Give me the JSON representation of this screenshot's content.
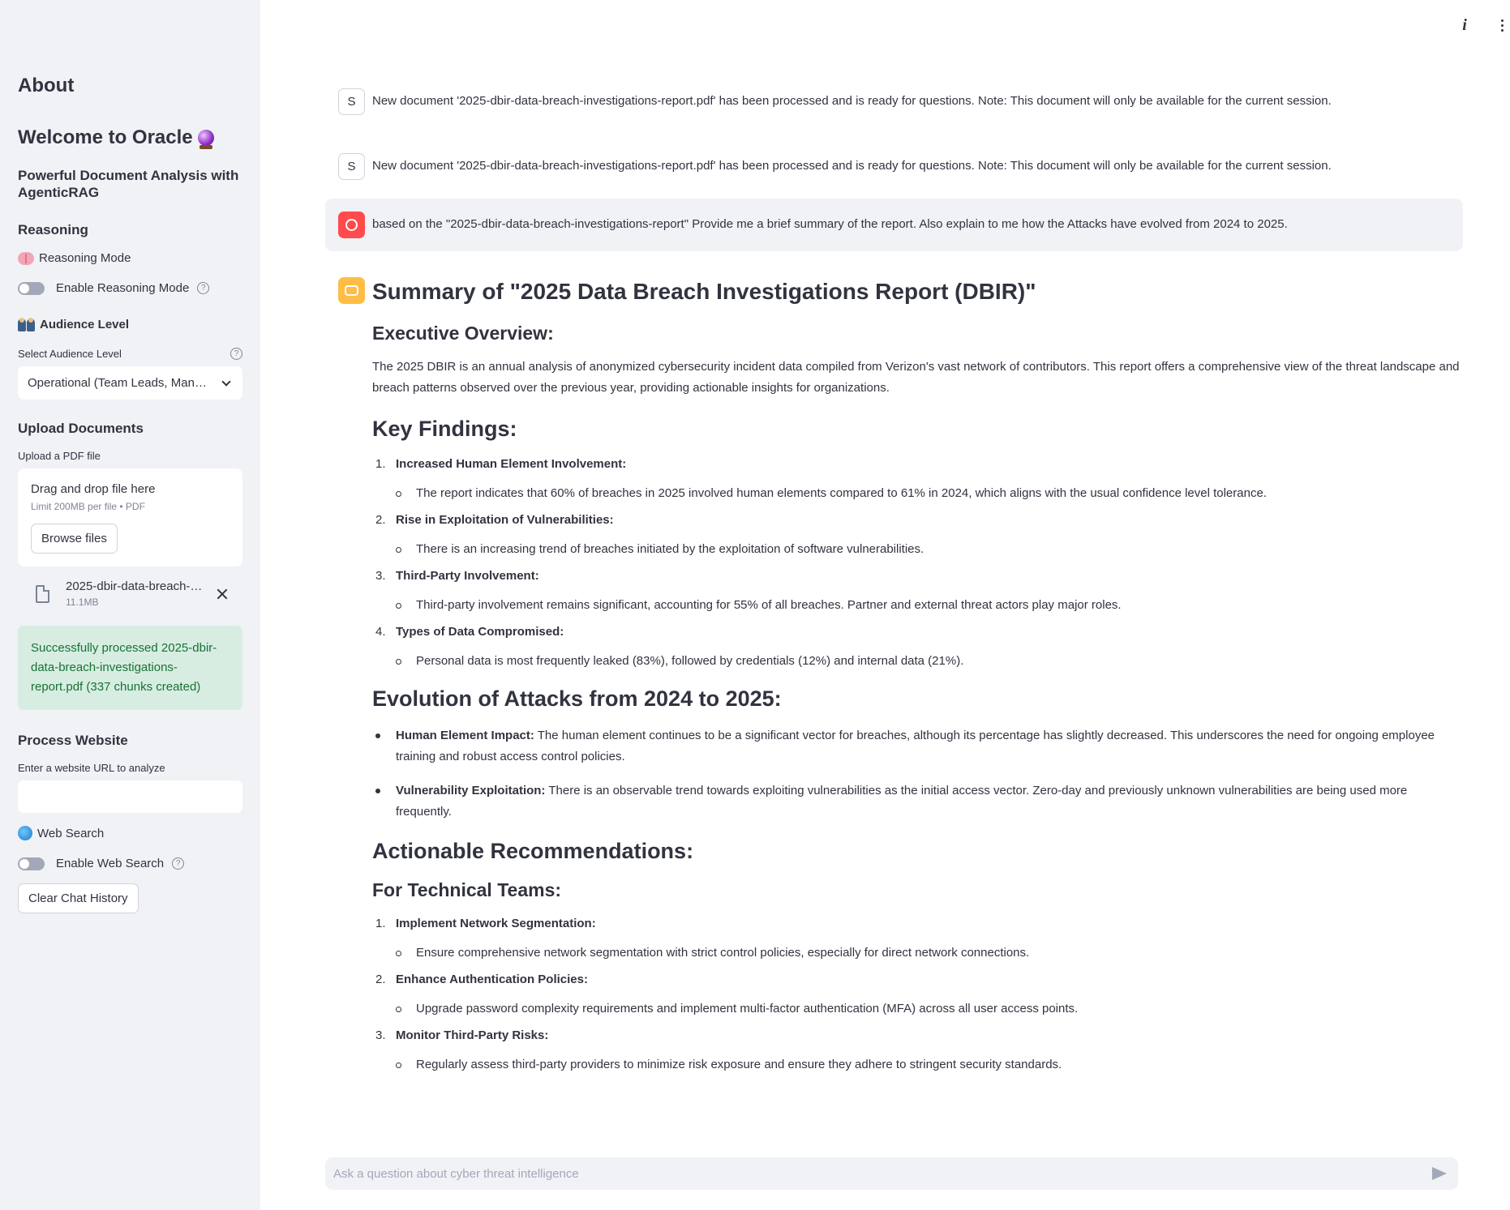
{
  "sidebar": {
    "about": "About",
    "welcome": "Welcome to Oracle",
    "subtitle": "Powerful Document Analysis with AgenticRAG",
    "reasoning": {
      "heading": "Reasoning",
      "mode_label": "Reasoning Mode",
      "toggle_label": "Enable Reasoning Mode"
    },
    "audience": {
      "heading": "Audience Level",
      "select_label": "Select Audience Level",
      "selected": "Operational (Team Leads, Man…"
    },
    "upload": {
      "heading": "Upload Documents",
      "label": "Upload a PDF file",
      "drop_text": "Drag and drop file here",
      "limit": "Limit 200MB per file • PDF",
      "browse": "Browse files",
      "file_name": "2025-dbir-data-breach-…",
      "file_size": "11.1MB",
      "success": "Successfully processed 2025-dbir-data-breach-investigations-report.pdf (337 chunks created)"
    },
    "website": {
      "heading": "Process Website",
      "label": "Enter a website URL to analyze",
      "value": ""
    },
    "web_search": {
      "label": "Web Search",
      "toggle_label": "Enable Web Search"
    },
    "clear_button": "Clear Chat History"
  },
  "chat": {
    "system_messages": [
      {
        "avatar": "S",
        "text": "New document '2025-dbir-data-breach-investigations-report.pdf' has been processed and is ready for questions. Note: This document will only be available for the current session."
      },
      {
        "avatar": "S",
        "text": "New document '2025-dbir-data-breach-investigations-report.pdf' has been processed and is ready for questions. Note: This document will only be available for the current session."
      }
    ],
    "user_message": "based on the \"2025-dbir-data-breach-investigations-report\" Provide me a brief summary of the report. Also explain to me how the Attacks have evolved from 2024 to 2025.",
    "response": {
      "title": "Summary of \"2025 Data Breach Investigations Report (DBIR)\"",
      "exec_heading": "Executive Overview:",
      "exec_text": "The 2025 DBIR is an annual analysis of anonymized cybersecurity incident data compiled from Verizon's vast network of contributors. This report offers a comprehensive view of the threat landscape and breach patterns observed over the previous year, providing actionable insights for organizations.",
      "key_heading": "Key Findings:",
      "key_findings": [
        {
          "num": "1.",
          "title": "Increased Human Element Involvement:",
          "detail": "The report indicates that 60% of breaches in 2025 involved human elements compared to 61% in 2024, which aligns with the usual confidence level tolerance."
        },
        {
          "num": "2.",
          "title": "Rise in Exploitation of Vulnerabilities:",
          "detail": "There is an increasing trend of breaches initiated by the exploitation of software vulnerabilities."
        },
        {
          "num": "3.",
          "title": "Third-Party Involvement:",
          "detail": "Third-party involvement remains significant, accounting for 55% of all breaches. Partner and external threat actors play major roles."
        },
        {
          "num": "4.",
          "title": "Types of Data Compromised:",
          "detail": "Personal data is most frequently leaked (83%), followed by credentials (12%) and internal data (21%)."
        }
      ],
      "evolution_heading": "Evolution of Attacks from 2024 to 2025:",
      "evolution": [
        {
          "title": "Human Element Impact:",
          "text": " The human element continues to be a significant vector for breaches, although its percentage has slightly decreased. This underscores the need for ongoing employee training and robust access control policies."
        },
        {
          "title": "Vulnerability Exploitation:",
          "text": " There is an observable trend towards exploiting vulnerabilities as the initial access vector. Zero-day and previously unknown vulnerabilities are being used more frequently."
        }
      ],
      "recs_heading": "Actionable Recommendations:",
      "tech_heading": "For Technical Teams:",
      "tech_recs": [
        {
          "num": "1.",
          "title": "Implement Network Segmentation:",
          "detail": "Ensure comprehensive network segmentation with strict control policies, especially for direct network connections."
        },
        {
          "num": "2.",
          "title": "Enhance Authentication Policies:",
          "detail": "Upgrade password complexity requirements and implement multi-factor authentication (MFA) across all user access points."
        },
        {
          "num": "3.",
          "title": "Monitor Third-Party Risks:",
          "detail": "Regularly assess third-party providers to minimize risk exposure and ensure they adhere to stringent security standards."
        }
      ]
    }
  },
  "chat_input": {
    "placeholder": "Ask a question about cyber threat intelligence"
  },
  "icons": {
    "info": "info-icon",
    "menu": "kebab-menu-icon",
    "help": "?"
  }
}
